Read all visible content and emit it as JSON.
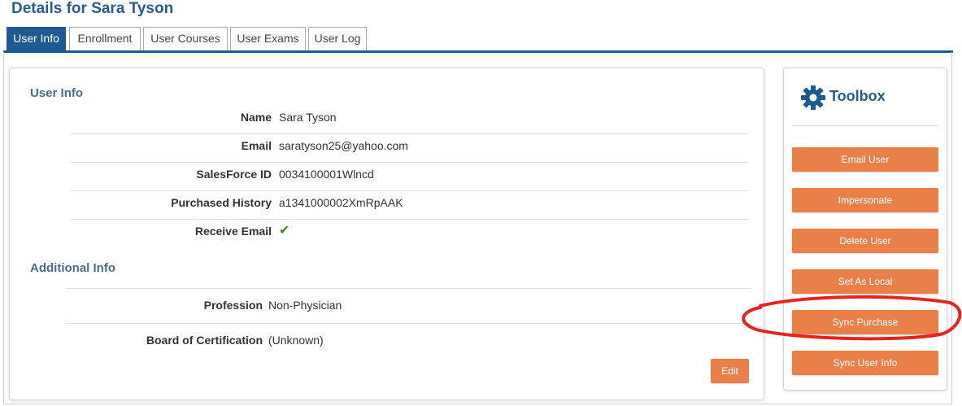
{
  "page": {
    "title": "Details for Sara Tyson"
  },
  "tabs": [
    {
      "label": "User Info",
      "active": true
    },
    {
      "label": "Enrollment",
      "active": false
    },
    {
      "label": "User Courses",
      "active": false
    },
    {
      "label": "User Exams",
      "active": false
    },
    {
      "label": "User Log",
      "active": false
    }
  ],
  "user_info": {
    "section_title": "User Info",
    "fields": [
      {
        "label": "Name",
        "value": "Sara Tyson"
      },
      {
        "label": "Email",
        "value": "saratyson25@yahoo.com"
      },
      {
        "label": "SalesForce ID",
        "value": "0034100001Wlncd"
      },
      {
        "label": "Purchased History",
        "value": "a1341000002XmRpAAK"
      },
      {
        "label": "Receive Email",
        "value": "✔"
      }
    ]
  },
  "additional_info": {
    "section_title": "Additional Info",
    "fields": [
      {
        "label": "Profession",
        "value": "Non-Physician"
      },
      {
        "label": "Board of Certification",
        "value": "(Unknown)"
      }
    ],
    "edit_label": "Edit"
  },
  "toolbox": {
    "title": "Toolbox",
    "icon": "gear-icon",
    "buttons": [
      "Email User",
      "Impersonate",
      "Delete User",
      "Set As Local",
      "Sync Purchase",
      "Sync User Info"
    ]
  },
  "colors": {
    "accent": "#1f5a92",
    "button": "#e9804a",
    "annotation": "#e8221f"
  }
}
